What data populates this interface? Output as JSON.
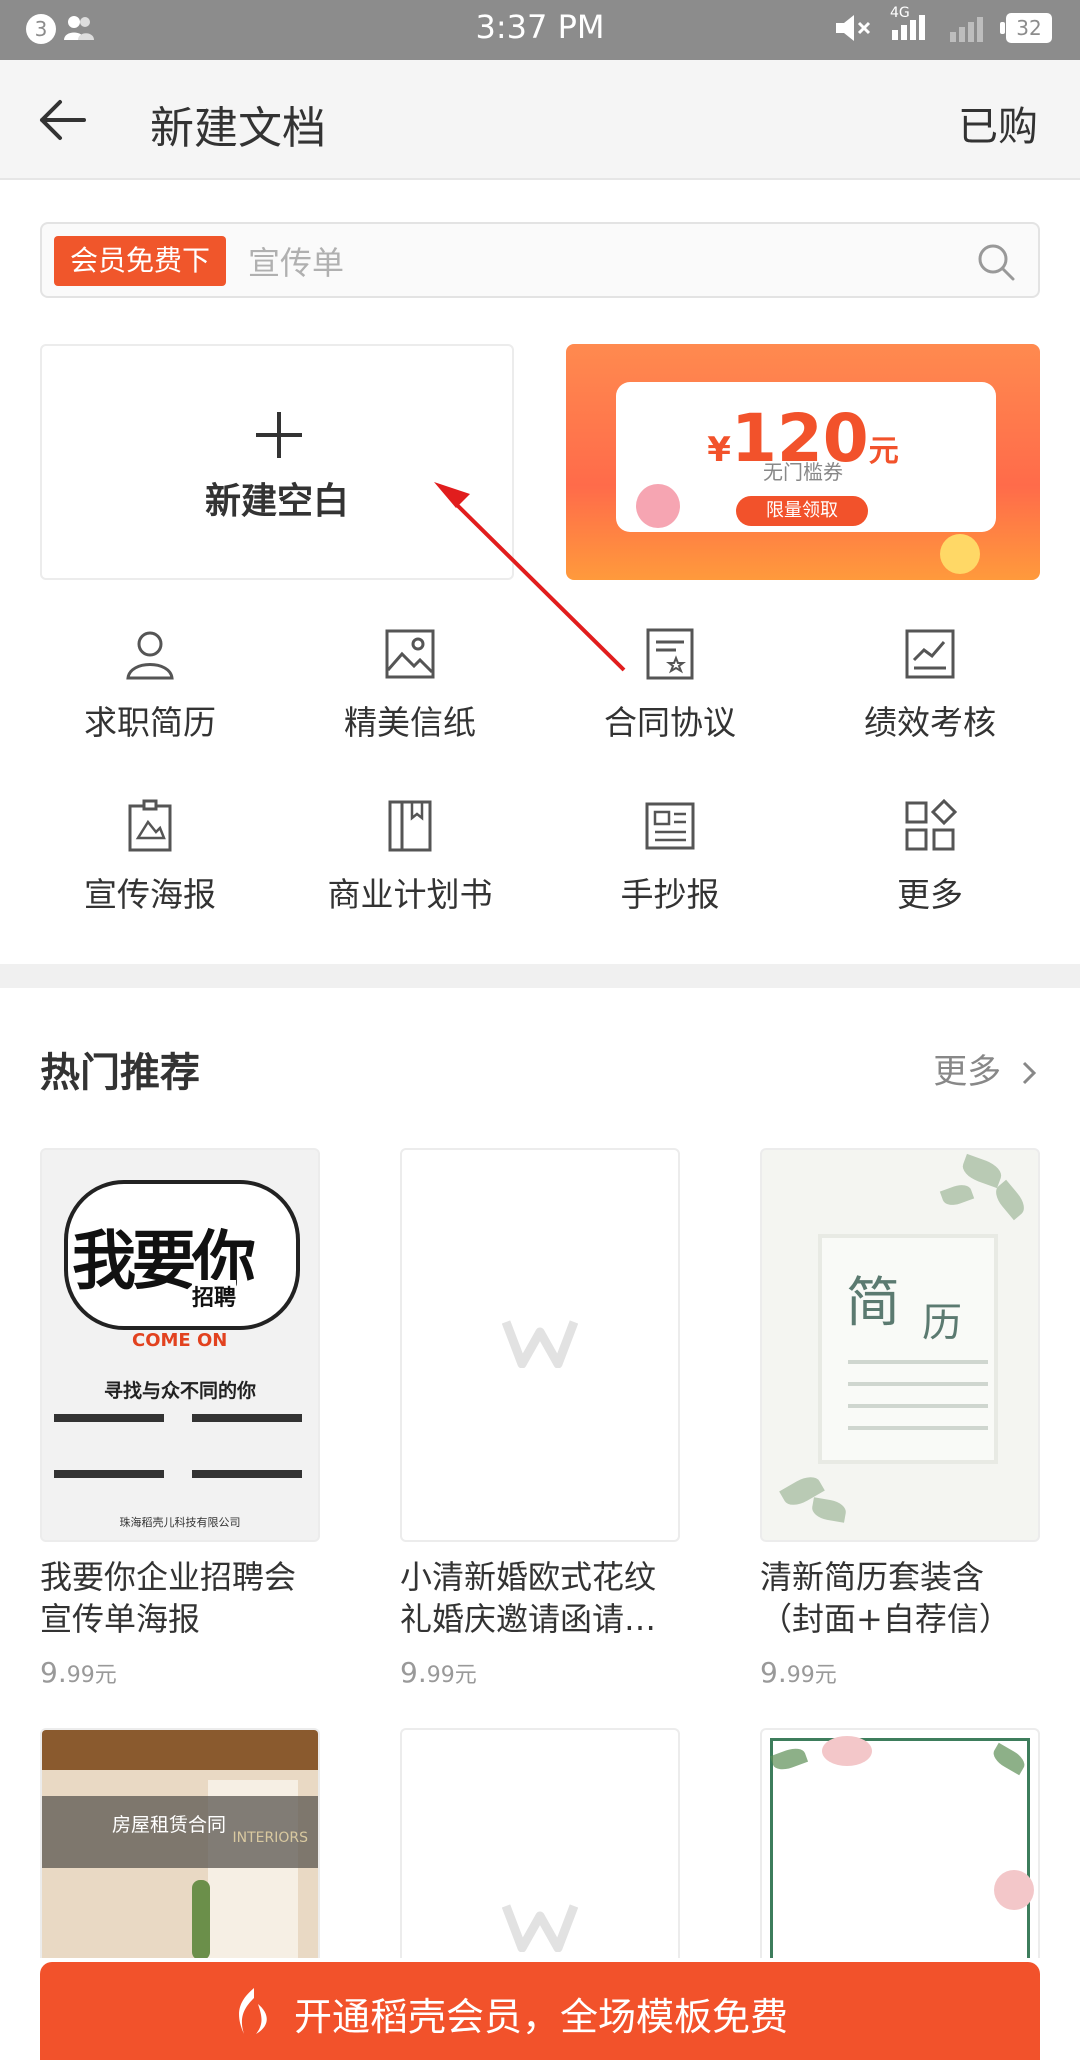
{
  "status_bar": {
    "notification_count": "3",
    "time": "3:37 PM",
    "network": "4G",
    "battery": "32"
  },
  "header": {
    "title": "新建文档",
    "right_action": "已购"
  },
  "search": {
    "badge": "会员免费下",
    "placeholder": "宣传单"
  },
  "new_blank": {
    "label": "新建空白"
  },
  "promo_banner": {
    "currency": "¥",
    "amount": "120",
    "unit": "元",
    "subtitle": "无门槛券",
    "button": "限量领取"
  },
  "categories": [
    {
      "label": "求职简历",
      "icon": "person-icon"
    },
    {
      "label": "精美信纸",
      "icon": "image-icon"
    },
    {
      "label": "合同协议",
      "icon": "contract-icon"
    },
    {
      "label": "绩效考核",
      "icon": "chart-icon"
    },
    {
      "label": "宣传海报",
      "icon": "poster-icon"
    },
    {
      "label": "商业计划书",
      "icon": "book-icon"
    },
    {
      "label": "手抄报",
      "icon": "newspaper-icon"
    },
    {
      "label": "更多",
      "icon": "grid-more-icon"
    }
  ],
  "section": {
    "title": "热门推荐",
    "more": "更多"
  },
  "templates": [
    {
      "name": "我要你企业招聘会宣传单海报",
      "price_int": "9.",
      "price_dec": "99元",
      "thumb": {
        "headline": "我要你",
        "sub": "招聘",
        "tagline": "COME ON",
        "line": "寻找与众不同的你",
        "footer": "珠海稻壳儿科技有限公司"
      }
    },
    {
      "name": "小清新婚欧式花纹礼婚庆邀请函请…",
      "price_int": "9.",
      "price_dec": "99元"
    },
    {
      "name": "清新简历套装含（封面+自荐信）",
      "price_int": "9.",
      "price_dec": "99元",
      "thumb": {
        "char1": "简",
        "char2": "历"
      }
    },
    {
      "name": "",
      "thumb": {
        "title": "房屋租赁合同",
        "sub": "INTERIORS"
      }
    },
    {
      "name": ""
    },
    {
      "name": ""
    }
  ],
  "cta": {
    "label": "开通稻壳会员，全场模板免费"
  },
  "colors": {
    "accent": "#f2522b",
    "status_bar": "#8c8c8c",
    "arrow": "#e11d1d"
  }
}
